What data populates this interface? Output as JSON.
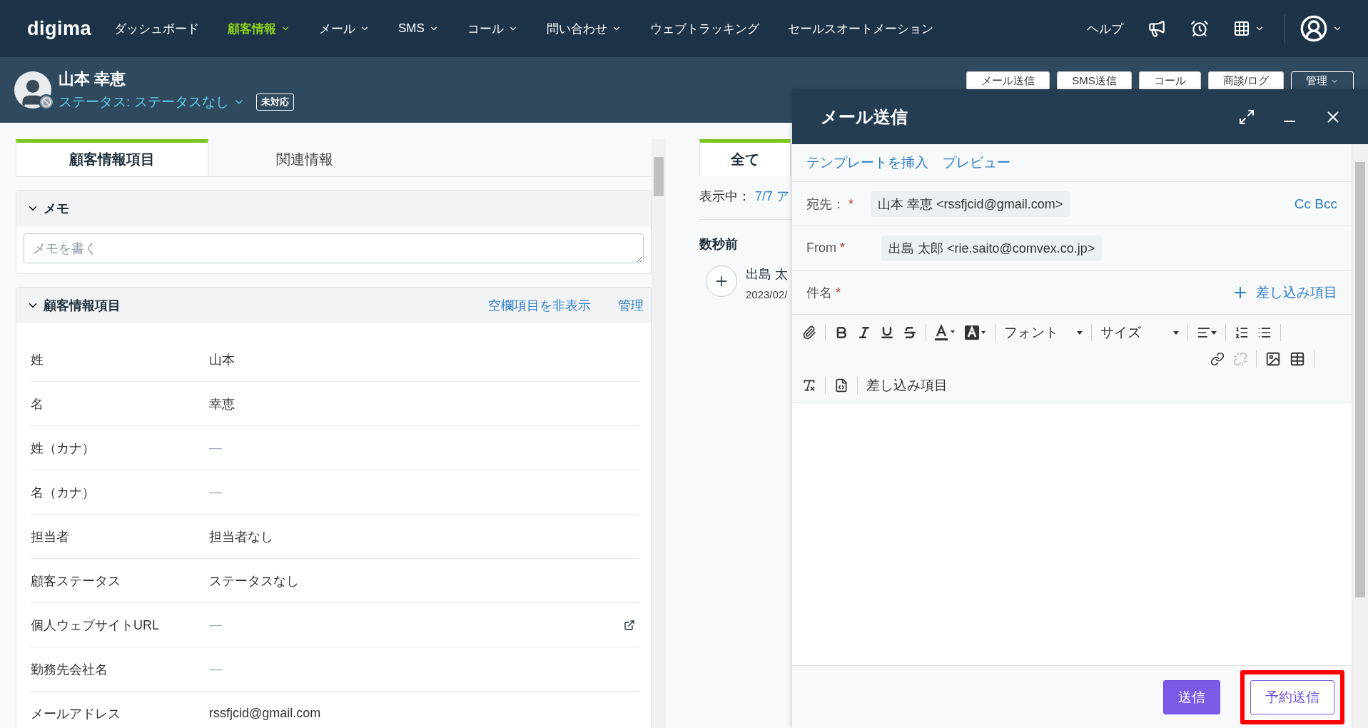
{
  "nav": {
    "logo": "digima",
    "items": [
      {
        "label": "ダッシュボード",
        "selected": false,
        "dropdown": false
      },
      {
        "label": "顧客情報",
        "selected": true,
        "dropdown": true
      },
      {
        "label": "メール",
        "selected": false,
        "dropdown": true
      },
      {
        "label": "SMS",
        "selected": false,
        "dropdown": true
      },
      {
        "label": "コール",
        "selected": false,
        "dropdown": true
      },
      {
        "label": "問い合わせ",
        "selected": false,
        "dropdown": true
      },
      {
        "label": "ウェブトラッキング",
        "selected": false,
        "dropdown": false
      },
      {
        "label": "セールスオートメーション",
        "selected": false,
        "dropdown": false
      }
    ],
    "help": "ヘルプ"
  },
  "customer": {
    "name": "山本 幸恵",
    "status": "ステータス: ステータスなし",
    "badge": "未対応"
  },
  "header_actions": [
    {
      "label": "メール送信",
      "kind": "button"
    },
    {
      "label": "SMS送信",
      "kind": "button"
    },
    {
      "label": "コール",
      "kind": "button"
    },
    {
      "label": "商談/ログ",
      "kind": "button"
    },
    {
      "label": "管理",
      "kind": "menu"
    }
  ],
  "left_panel": {
    "tabs": [
      {
        "label": "顧客情報項目",
        "selected": true
      },
      {
        "label": "関連情報",
        "selected": false
      }
    ],
    "memo": {
      "title": "メモ",
      "expanded": true,
      "placeholder": "メモを書く"
    },
    "fields": {
      "title": "顧客情報項目",
      "expanded": true,
      "actions": [
        "空欄項目を非表示",
        "管理"
      ],
      "rows": [
        {
          "label": "姓",
          "value": "山本",
          "kind": "text"
        },
        {
          "label": "名",
          "value": "幸恵",
          "kind": "text"
        },
        {
          "label": "姓（カナ）",
          "value": "—",
          "kind": "empty"
        },
        {
          "label": "名（カナ）",
          "value": "—",
          "kind": "empty"
        },
        {
          "label": "担当者",
          "value": "担当者なし",
          "kind": "text"
        },
        {
          "label": "顧客ステータス",
          "value": "ステータスなし",
          "kind": "text"
        },
        {
          "label": "個人ウェブサイトURL",
          "value": "—",
          "kind": "link"
        },
        {
          "label": "勤務先会社名",
          "value": "—",
          "kind": "empty"
        },
        {
          "label": "メールアドレス",
          "value": "rssfjcid@gmail.com",
          "kind": "text"
        }
      ]
    }
  },
  "activity": {
    "tab": "全て",
    "showing_label": "表示中：",
    "showing_value": "7/7 ア",
    "group": "数秒前",
    "item": {
      "title": "出島 太",
      "date": "2023/02/"
    }
  },
  "compose": {
    "title": "メール送信",
    "links": [
      "テンプレートを挿入",
      "プレビュー"
    ],
    "to": {
      "label": "宛先：",
      "mark": "*",
      "chip": "山本 幸恵 <rssfjcid@gmail.com>",
      "extra": "Cc Bcc"
    },
    "from": {
      "label": "From",
      "mark": "*",
      "chip": "出島 太郎 <rie.saito@comvex.co.jp>"
    },
    "subject": {
      "label": "件名",
      "mark": "*",
      "insert": "差し込み項目"
    },
    "toolbar": {
      "font": "フォント",
      "size": "サイズ",
      "insert": "差し込み項目"
    },
    "buttons": [
      {
        "label": "送信",
        "kind": "primary",
        "highlighted": false
      },
      {
        "label": "予約送信",
        "kind": "outline",
        "highlighted": true
      }
    ]
  }
}
